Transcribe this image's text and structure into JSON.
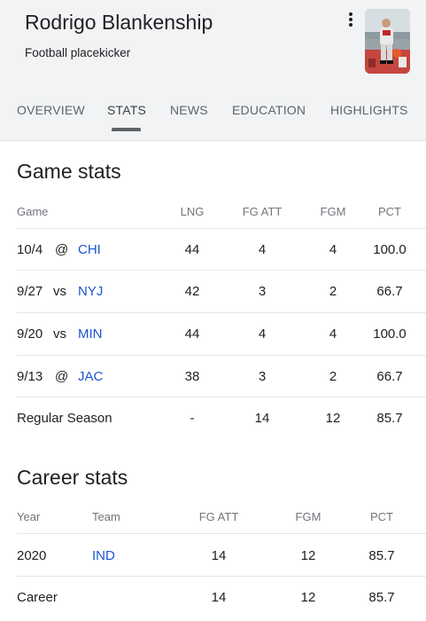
{
  "profile": {
    "name": "Rodrigo Blankenship",
    "description": "Football placekicker"
  },
  "tabs": [
    "OVERVIEW",
    "STATS",
    "NEWS",
    "EDUCATION",
    "HIGHLIGHTS"
  ],
  "active_tab": "STATS",
  "game_stats": {
    "title": "Game stats",
    "headers": {
      "game": "Game",
      "lng": "LNG",
      "fg_att": "FG ATT",
      "fgm": "FGM",
      "pct": "PCT"
    },
    "rows": [
      {
        "date": "10/4",
        "loc": "@",
        "opp": "CHI",
        "lng": "44",
        "fg_att": "4",
        "fgm": "4",
        "pct": "100.0"
      },
      {
        "date": "9/27",
        "loc": "vs",
        "opp": "NYJ",
        "lng": "42",
        "fg_att": "3",
        "fgm": "2",
        "pct": "66.7"
      },
      {
        "date": "9/20",
        "loc": "vs",
        "opp": "MIN",
        "lng": "44",
        "fg_att": "4",
        "fgm": "4",
        "pct": "100.0"
      },
      {
        "date": "9/13",
        "loc": "@",
        "opp": "JAC",
        "lng": "38",
        "fg_att": "3",
        "fgm": "2",
        "pct": "66.7"
      }
    ],
    "summary": {
      "label": "Regular Season",
      "lng": "-",
      "fg_att": "14",
      "fgm": "12",
      "pct": "85.7"
    }
  },
  "career_stats": {
    "title": "Career stats",
    "headers": {
      "year": "Year",
      "team": "Team",
      "fg_att": "FG ATT",
      "fgm": "FGM",
      "pct": "PCT"
    },
    "rows": [
      {
        "year": "2020",
        "team": "IND",
        "fg_att": "14",
        "fgm": "12",
        "pct": "85.7"
      },
      {
        "year": "Career",
        "team": "",
        "fg_att": "14",
        "fgm": "12",
        "pct": "85.7"
      }
    ]
  },
  "colors": {
    "link": "#1a55d1",
    "header_bg": "#f1f3f4"
  }
}
